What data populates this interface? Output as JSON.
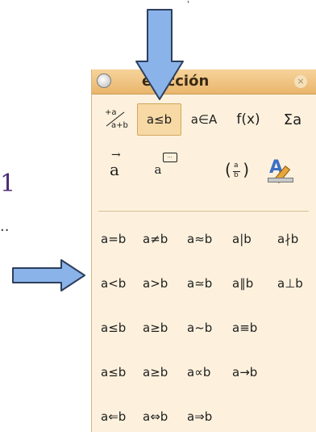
{
  "background": {
    "digit": "1",
    "ellipsis": "..",
    "mark": "'"
  },
  "panel": {
    "title": "elección",
    "close_glyph": "×"
  },
  "toolbar": {
    "unary_binary": {
      "numerator": "+a",
      "denominator": "a+b"
    },
    "relations": "a≤b",
    "set_operations": "a∈A",
    "functions": "f(x)",
    "operators": "Σa",
    "attributes": "a⃗",
    "others": {
      "base": "a",
      "bubble": "..."
    },
    "brackets": {
      "top": "a",
      "bottom": "b"
    },
    "formats": "A"
  },
  "symbols": {
    "row1": [
      "a=b",
      "a≠b",
      "a≈b",
      "a|b",
      "a∤b"
    ],
    "row2": [
      "a<b",
      "a>b",
      "a≃b",
      "a∥b",
      "a⊥b"
    ],
    "row3": [
      "a≤b",
      "a≥b",
      "a~b",
      "a≡b"
    ],
    "row4": [
      "a≤b",
      "a≥b",
      "a∝b",
      "a→b"
    ],
    "row5": [
      "a⇐b",
      "a⇔b",
      "a⇒b"
    ]
  },
  "colors": {
    "panel_bg": "#fdf1dd",
    "titlebar": "#e9b66c",
    "selected": "#f6d9a4",
    "arrow_fill": "#8ab3ea",
    "arrow_stroke": "#2c3f5c"
  }
}
